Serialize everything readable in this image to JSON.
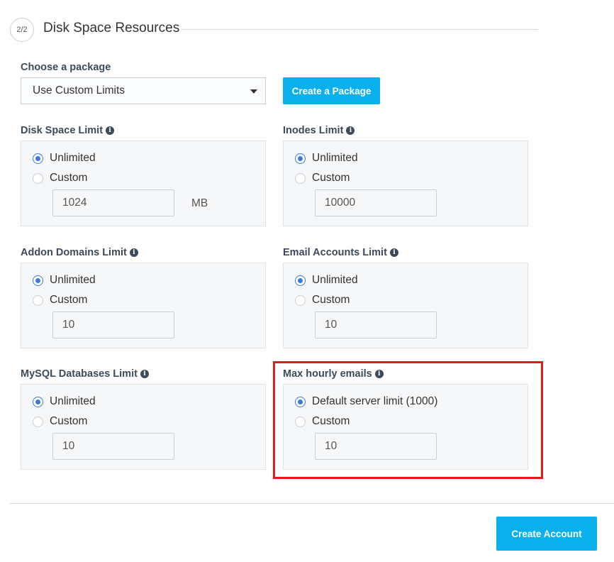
{
  "step": {
    "badge": "2/2",
    "title": "Disk Space Resources"
  },
  "package": {
    "label": "Choose a package",
    "selected": "Use Custom Limits",
    "create_button": "Create a Package"
  },
  "limits": [
    {
      "label": "Disk Space Limit",
      "option_default": "Unlimited",
      "option_custom": "Custom",
      "value": "1024",
      "unit": "MB"
    },
    {
      "label": "Inodes Limit",
      "option_default": "Unlimited",
      "option_custom": "Custom",
      "value": "10000"
    },
    {
      "label": "Addon Domains Limit",
      "option_default": "Unlimited",
      "option_custom": "Custom",
      "value": "10"
    },
    {
      "label": "Email Accounts Limit",
      "option_default": "Unlimited",
      "option_custom": "Custom",
      "value": "10"
    },
    {
      "label": "MySQL Databases Limit",
      "option_default": "Unlimited",
      "option_custom": "Custom",
      "value": "10"
    },
    {
      "label": "Max hourly emails",
      "option_default": "Default server limit (1000)",
      "option_custom": "Custom",
      "value": "10"
    }
  ],
  "footer": {
    "create_account": "Create Account"
  },
  "colors": {
    "accent": "#0ab0ec",
    "radio_selected": "#3a7bd5",
    "highlight": "#e41b1b"
  },
  "icons": {
    "info": "info-circle-icon",
    "dropdown": "chevron-down-icon"
  }
}
